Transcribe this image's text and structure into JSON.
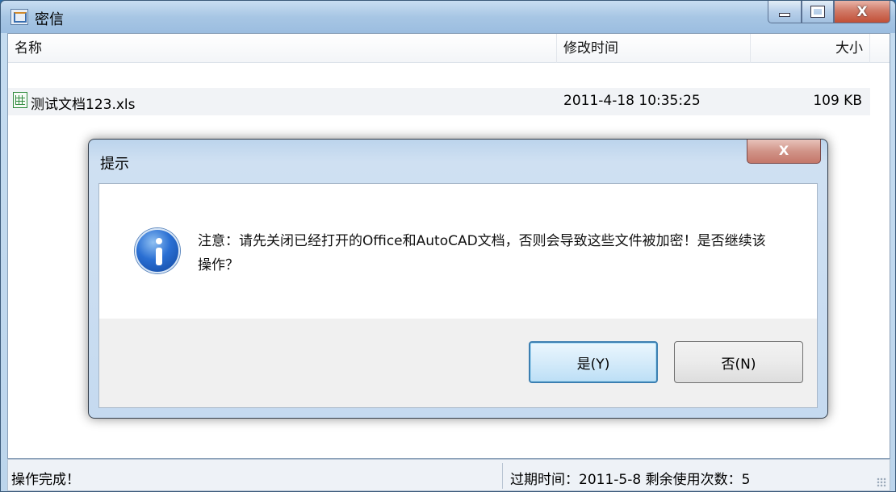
{
  "window": {
    "title": "密信"
  },
  "columns": {
    "name": "名称",
    "modified": "修改时间",
    "size": "大小"
  },
  "files": [
    {
      "name": "测试文档123.xls",
      "modified": "2011-4-18 10:35:25",
      "size": "109 KB",
      "icon": "excel-file-icon"
    }
  ],
  "status": {
    "left": "操作完成！",
    "right": "过期时间：2011-5-8 剩余使用次数：5"
  },
  "dialog": {
    "title": "提示",
    "close_glyph": "X",
    "message": "注意：请先关闭已经打开的Office和AutoCAD文档，否则会导致这些文件被加密！是否继续该操作？",
    "icon": "info-icon",
    "yes_label": "是(Y)",
    "no_label": "否(N)"
  },
  "colors": {
    "accent": "#3c7fb1",
    "close": "#c24f36"
  }
}
